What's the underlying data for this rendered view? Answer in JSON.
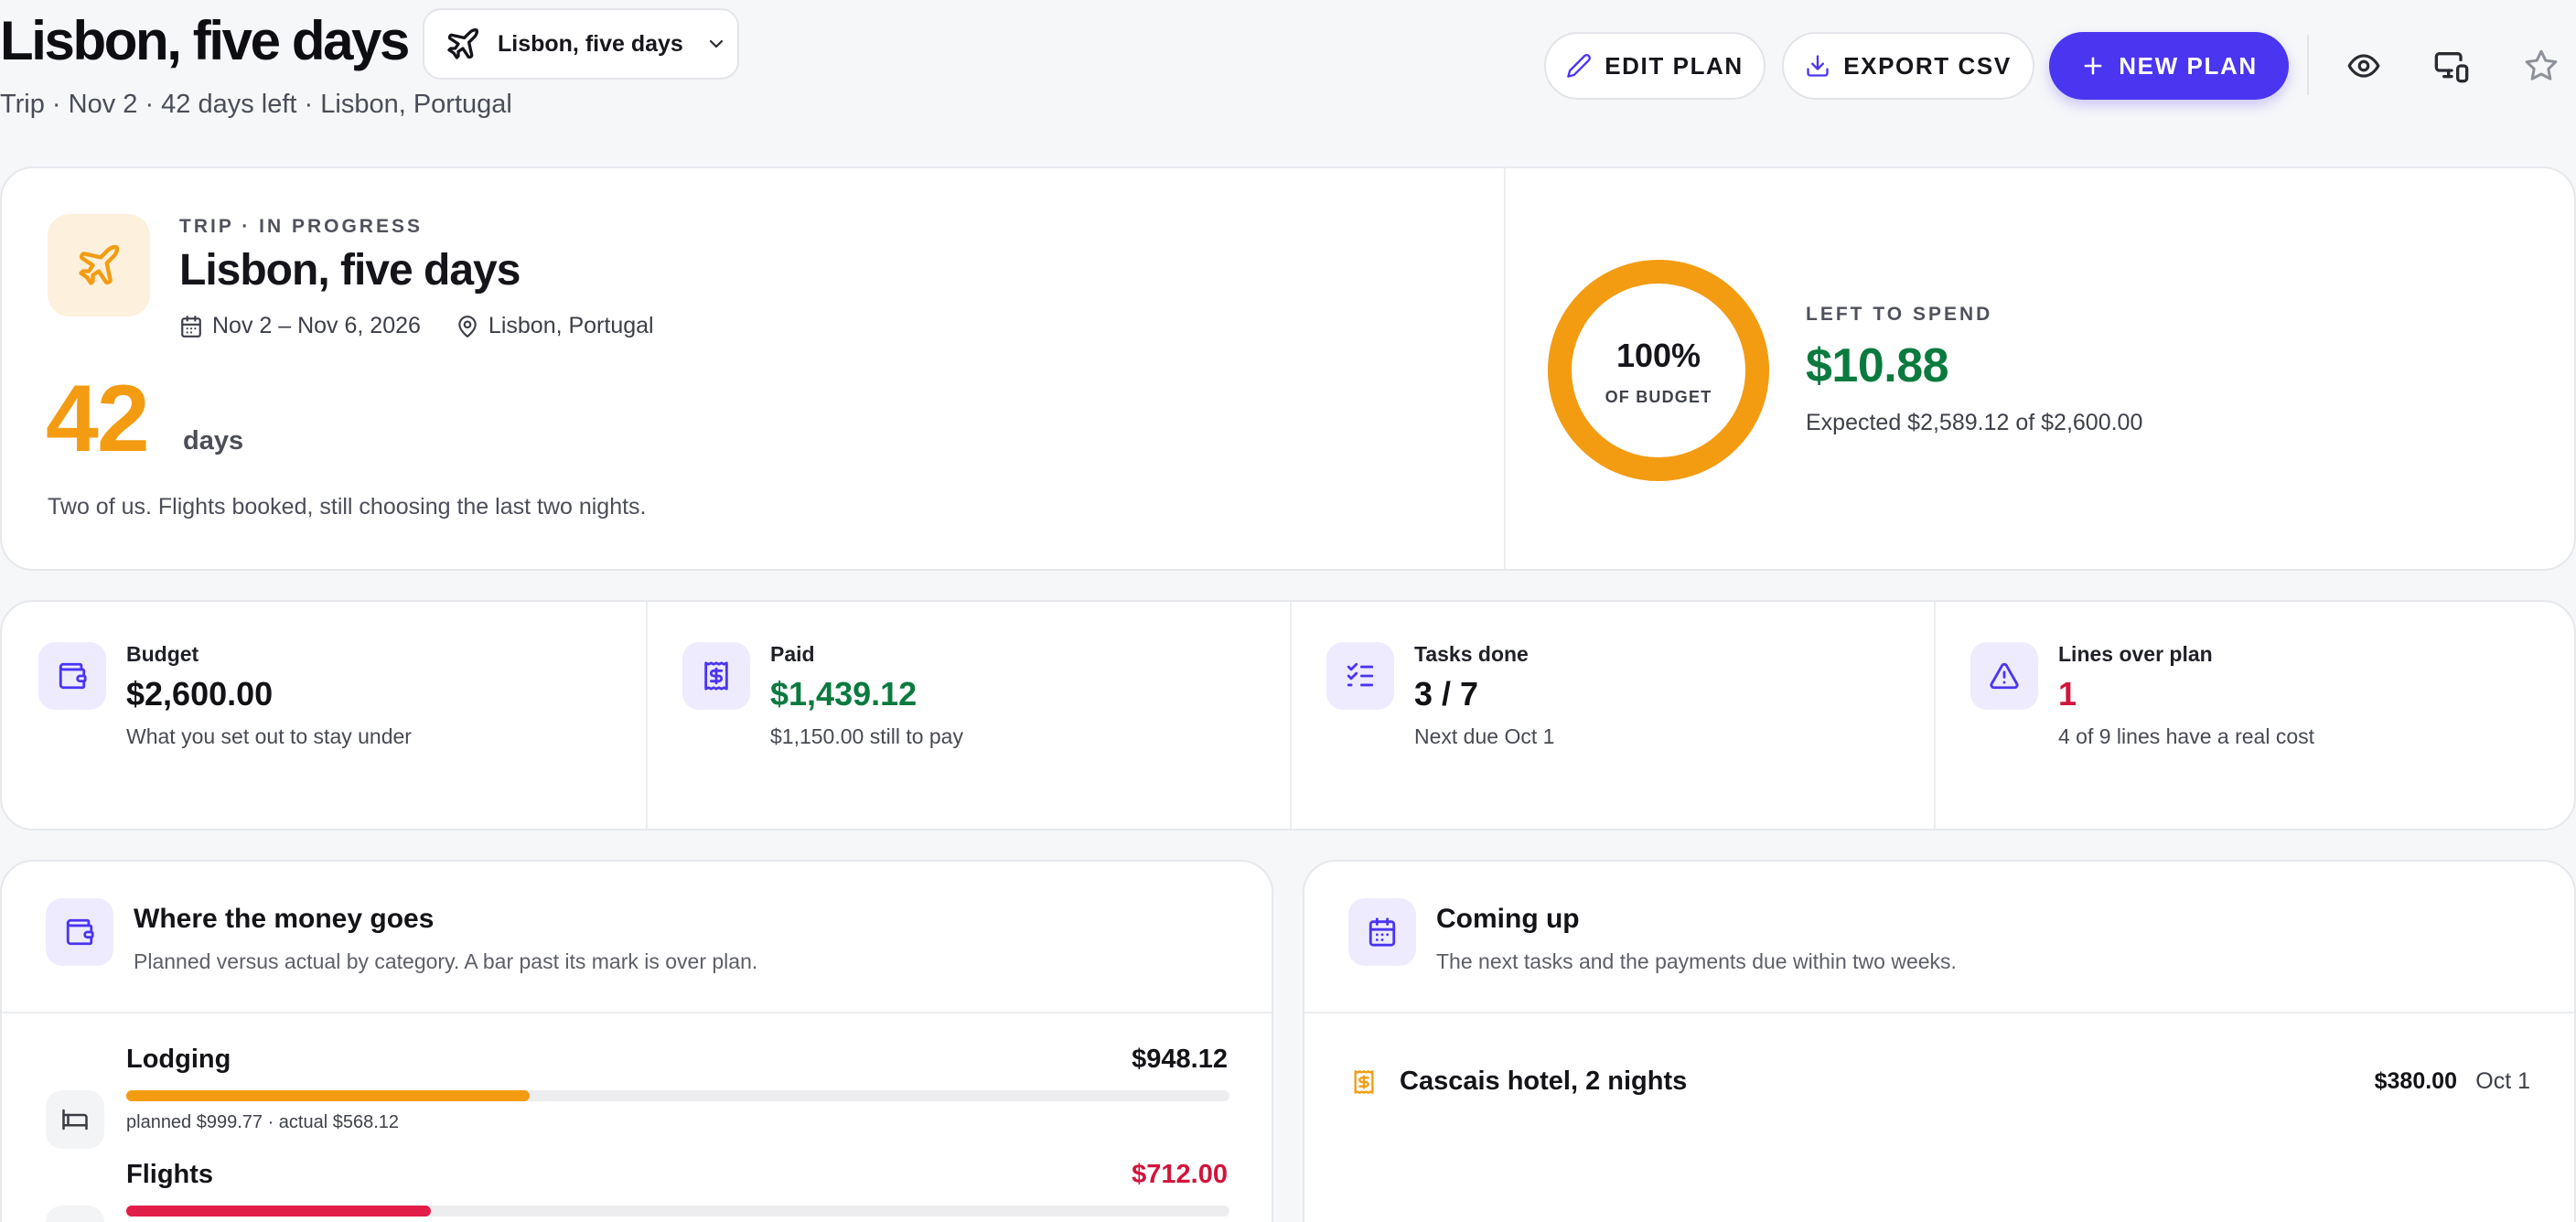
{
  "header": {
    "title": "Lisbon, five days",
    "plan_selector": "Lisbon, five days",
    "subtitle": "Trip · Nov 2 · 42 days left · Lisbon, Portugal",
    "edit_label": "EDIT PLAN",
    "export_label": "EXPORT CSV",
    "new_label": "NEW PLAN",
    "icons": [
      "eye-icon",
      "devices-icon",
      "star-icon"
    ]
  },
  "hero": {
    "eyebrow": "TRIP · IN PROGRESS",
    "title": "Lisbon, five days",
    "dates": "Nov 2 – Nov 6, 2026",
    "location": "Lisbon, Portugal",
    "days_value": "42",
    "days_label": "days",
    "note": "Two of us. Flights booked, still choosing the last two nights.",
    "budget_percent": "100%",
    "budget_percent_value": 100,
    "budget_label": "OF BUDGET",
    "left_label": "LEFT TO SPEND",
    "left_value": "$10.88",
    "expected": "Expected $2,589.12 of $2,600.00"
  },
  "stats": [
    {
      "label": "Budget",
      "value": "$2,600.00",
      "sub": "What you set out to stay under",
      "icon": "wallet-icon"
    },
    {
      "label": "Paid",
      "value": "$1,439.12",
      "sub": "$1,150.00 still to pay",
      "icon": "receipt-icon"
    },
    {
      "label": "Tasks done",
      "value": "3 / 7",
      "sub": "Next due Oct 1",
      "icon": "checklist-icon"
    },
    {
      "label": "Lines over plan",
      "value": "1",
      "sub": "4 of 9 lines have a real cost",
      "icon": "warning-icon"
    }
  ],
  "money": {
    "title": "Where the money goes",
    "subtitle": "Planned versus actual by category. A bar past its mark is over plan.",
    "categories": [
      {
        "name": "Lodging",
        "amount": "$948.12",
        "sub": "planned $999.77 · actual $568.12",
        "fill_percent": 36.6,
        "color": "#f39c12",
        "icon": "bed-icon"
      },
      {
        "name": "Flights",
        "amount": "$712.00",
        "fill_percent": 27.6,
        "color": "#e11d48",
        "icon": "plane-icon"
      }
    ]
  },
  "coming": {
    "title": "Coming up",
    "subtitle": "The next tasks and the payments due within two weeks.",
    "items": [
      {
        "name": "Cascais hotel, 2 nights",
        "amount": "$380.00",
        "date": "Oct 1",
        "icon": "receipt-icon"
      }
    ]
  },
  "colors": {
    "accent": "#4a35f0",
    "orange": "#f39c12",
    "green": "#0b7a3e",
    "red": "#d2143c"
  }
}
